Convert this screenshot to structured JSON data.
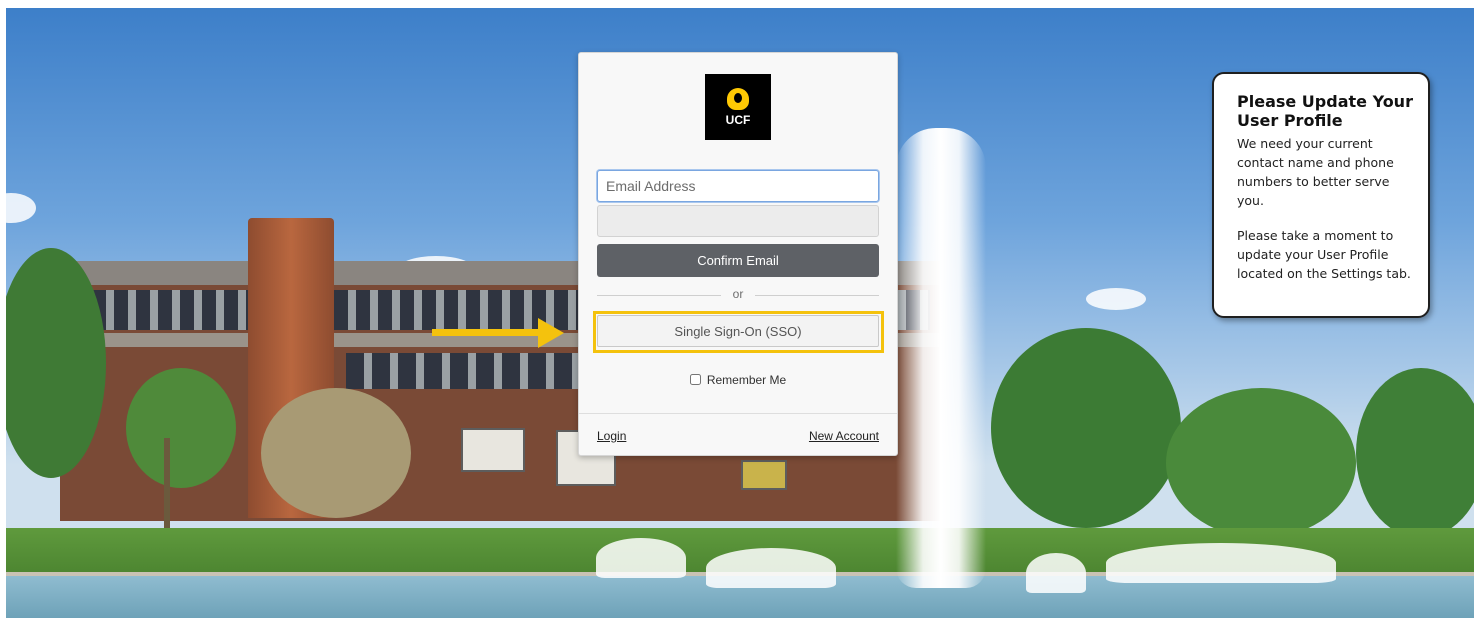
{
  "logo": {
    "text": "UCF",
    "brand_color": "#FFC904"
  },
  "login_form": {
    "email_placeholder": "Email Address",
    "confirm_button": "Confirm Email",
    "divider_text": "or",
    "sso_button": "Single Sign-On (SSO)",
    "remember_label": "Remember Me",
    "login_link": "Login",
    "new_account_link": "New Account"
  },
  "annotation": {
    "arrow_color": "#F4C20D",
    "highlight_color": "#F4C20D"
  },
  "callout": {
    "title": "Please Update Your User Profile",
    "paragraph_1": "We need your current contact name and phone numbers to better serve you.",
    "paragraph_2": "Please take a moment to update your User Profile located on the Settings tab."
  }
}
